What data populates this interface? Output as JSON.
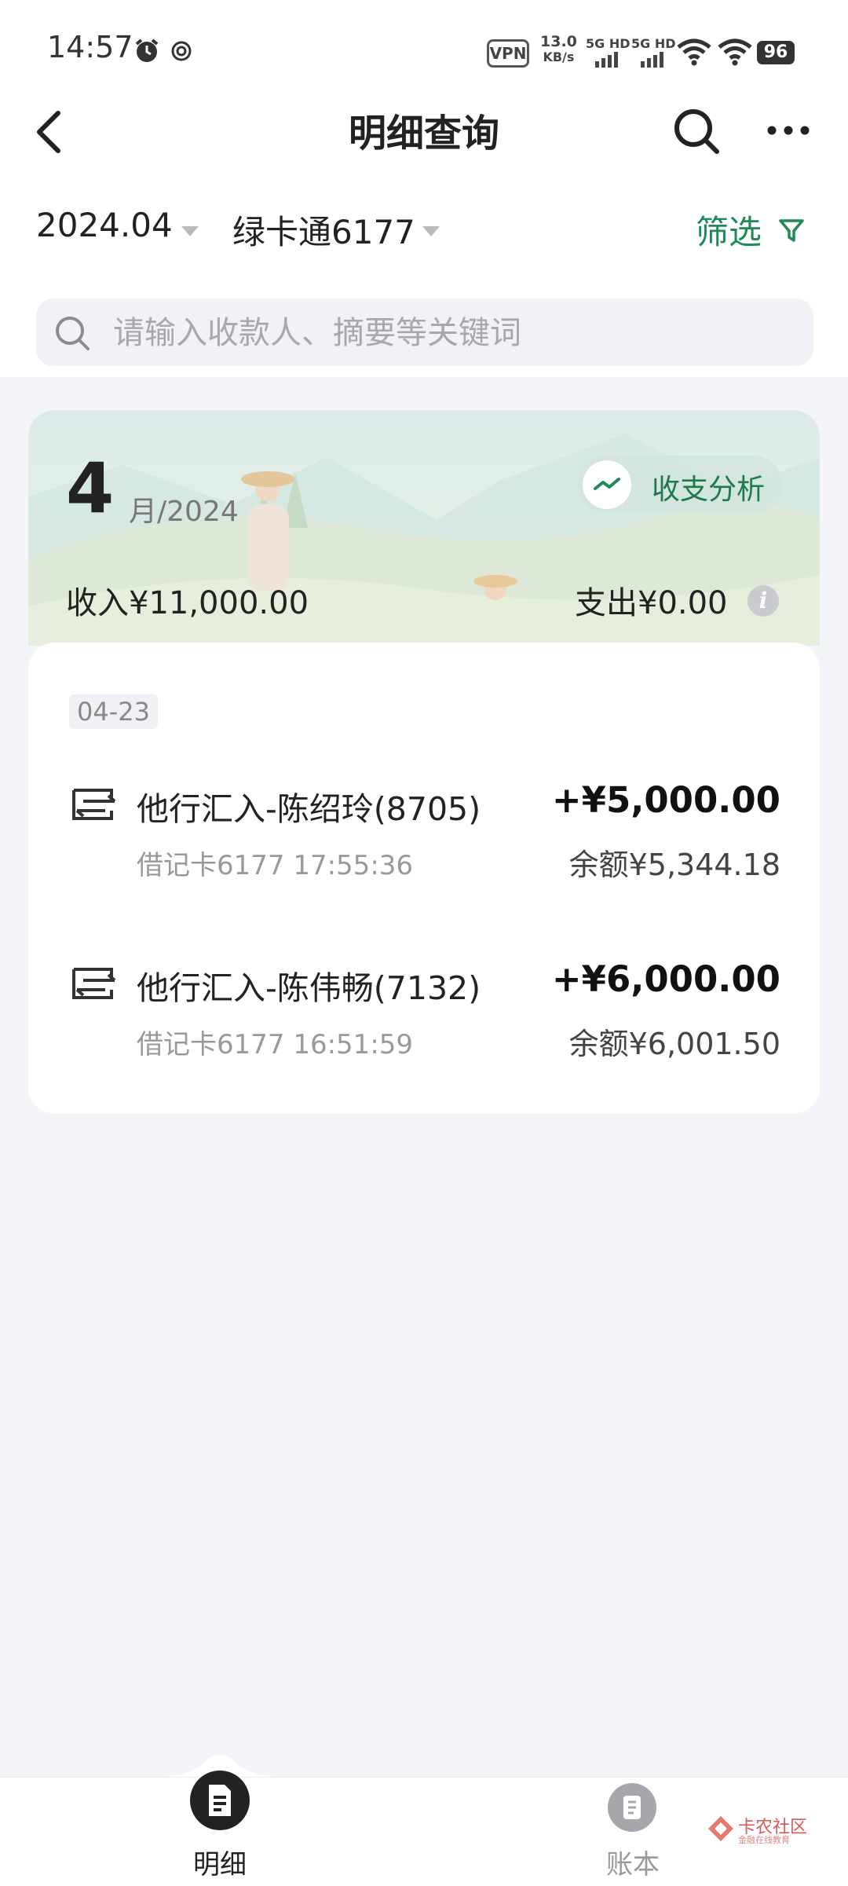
{
  "status_bar": {
    "time": "14:57",
    "vpn": "VPN",
    "speed_value": "13.0",
    "speed_unit": "KB/s",
    "net1": "5G HD",
    "net2": "5G HD",
    "battery": "96"
  },
  "header": {
    "title": "明细查询"
  },
  "filters": {
    "month": "2024.04",
    "card": "绿卡通6177",
    "filter_label": "筛选"
  },
  "search": {
    "placeholder": "请输入收款人、摘要等关键词"
  },
  "summary": {
    "month_number": "4",
    "month_suffix": "月/2024",
    "analysis_label": "收支分析",
    "income": "收入¥11,000.00",
    "expense": "支出¥0.00",
    "info_glyph": "i"
  },
  "transactions": {
    "date": "04-23",
    "items": [
      {
        "title": "他行汇入-陈绍玲(8705)",
        "sub": "借记卡6177 17:55:36",
        "amount": "+¥5,000.00",
        "balance": "余额¥5,344.18"
      },
      {
        "title": "他行汇入-陈伟畅(7132)",
        "sub": "借记卡6177 16:51:59",
        "amount": "+¥6,000.00",
        "balance": "余额¥6,001.50"
      }
    ]
  },
  "bottom_nav": {
    "tabs": [
      {
        "label": "明细",
        "active": true
      },
      {
        "label": "账本",
        "active": false
      }
    ]
  },
  "watermark": {
    "text": "卡农社区",
    "subtext": "金融在线教育"
  },
  "colors": {
    "accent_green": "#1e8a56",
    "background": "#f4f5f9"
  }
}
